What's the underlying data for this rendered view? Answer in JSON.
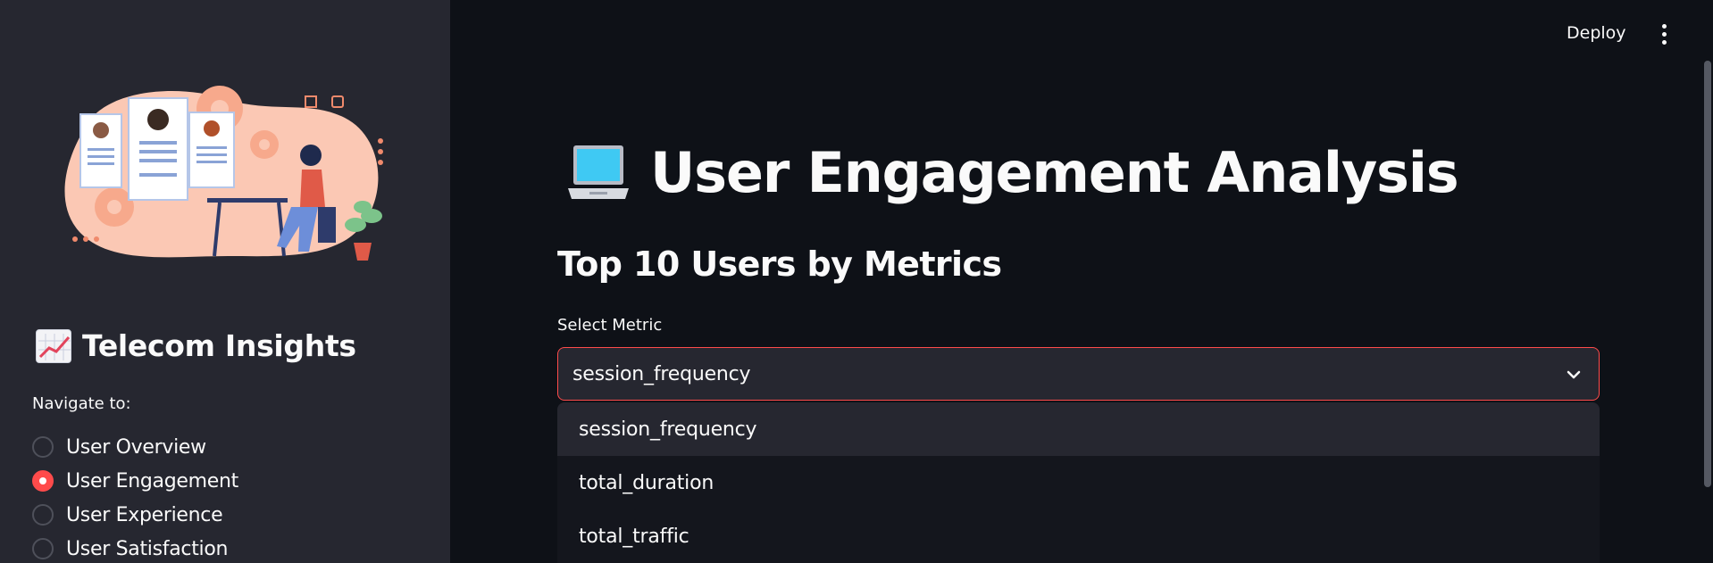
{
  "header": {
    "deploy_label": "Deploy",
    "menu_icon": "kebab-menu-icon"
  },
  "sidebar": {
    "illustration_icon": "user-profiles-illustration",
    "title_icon": "chart-increasing-icon",
    "title": "Telecom Insights",
    "nav_label": "Navigate to:",
    "nav_options": [
      {
        "label": "User Overview",
        "selected": false
      },
      {
        "label": "User Engagement",
        "selected": true
      },
      {
        "label": "User Experience",
        "selected": false
      },
      {
        "label": "User Satisfaction",
        "selected": false
      }
    ]
  },
  "main": {
    "title_icon": "laptop-icon",
    "title": "User Engagement Analysis",
    "subheader": "Top 10 Users by Metrics",
    "select": {
      "label": "Select Metric",
      "value": "session_frequency",
      "options": [
        "session_frequency",
        "total_duration",
        "total_traffic"
      ]
    }
  },
  "colors": {
    "background": "#0e1117",
    "sidebar": "#262730",
    "accent": "#ff4b4b",
    "text": "#fafafa"
  }
}
